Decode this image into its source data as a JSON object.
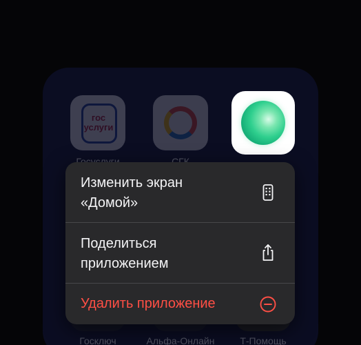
{
  "folder": {
    "apps": [
      {
        "label": "Госуслуги",
        "icon": "gosuslugi-icon",
        "icon_text": "гос услуги"
      },
      {
        "label": "СГК",
        "icon": "sgk-icon"
      },
      {
        "label": "Госключ",
        "icon": "goskey-icon"
      },
      {
        "label": "Альфа-Онлайн",
        "icon": "alfa-icon"
      },
      {
        "label": "Т-Помощь",
        "icon": "t-help-icon"
      }
    ]
  },
  "focused_app": {
    "icon": "green-orb-icon"
  },
  "menu": {
    "items": [
      {
        "label_line1": "Изменить экран",
        "label_line2": "«Домой»",
        "icon": "phone-screen-icon"
      },
      {
        "label_line1": "Поделиться",
        "label_line2": "приложением",
        "icon": "share-icon"
      },
      {
        "label": "Удалить приложение",
        "icon": "minus-circle-icon",
        "color": "#ff4f45"
      }
    ]
  }
}
